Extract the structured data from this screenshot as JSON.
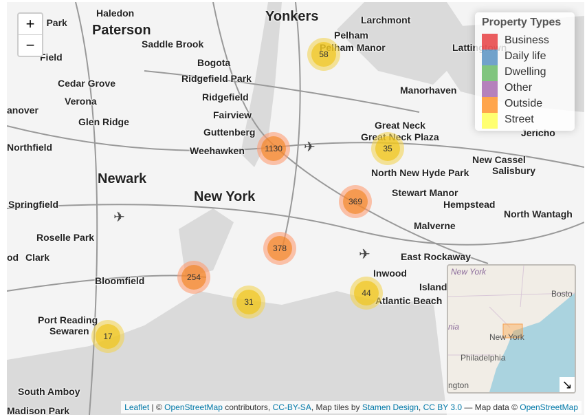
{
  "map_labels": [
    "Haledon",
    "Yonkers",
    "Larchmont",
    "Paterson",
    "Pelham",
    "Pelham Manor",
    "Lattingtown",
    "n Park",
    "Saddle Brook",
    "Bogota",
    "Field",
    "Ridgefield Park",
    "Cedar Grove",
    "Ridgefield",
    "Manorhaven",
    "Verona",
    "Fairview",
    "anover",
    "Glen Ridge",
    "Guttenberg",
    "Great Neck",
    "Great Neck Plaza",
    "Jericho",
    "Weehawken",
    "New Cassel",
    "Northfield",
    "Salisbury",
    "Newark",
    "North New Hyde Park",
    "New York",
    "Stewart Manor",
    "Springfield",
    "Hempstead",
    "North Wantagh",
    "Malverne",
    "Roselle Park",
    "od",
    "Clark",
    "East Rockaway",
    "Inwood",
    "Bloomfield",
    "Island",
    "Atlantic Beach",
    "Port Reading",
    "Sewaren",
    "South Amboy",
    "Madison Park"
  ],
  "clusters": [
    {
      "count": "58",
      "color": "yellow"
    },
    {
      "count": "1130",
      "color": "orange"
    },
    {
      "count": "35",
      "color": "yellow"
    },
    {
      "count": "369",
      "color": "orange"
    },
    {
      "count": "378",
      "color": "orange"
    },
    {
      "count": "254",
      "color": "orange"
    },
    {
      "count": "31",
      "color": "yellow"
    },
    {
      "count": "44",
      "color": "yellow"
    },
    {
      "count": "17",
      "color": "yellow"
    }
  ],
  "zoom": {
    "in": "+",
    "out": "−"
  },
  "legend": {
    "title": "Property Types",
    "items": [
      {
        "label": "Business",
        "color": "#e41a1c"
      },
      {
        "label": "Daily life",
        "color": "#377eb8"
      },
      {
        "label": "Dwelling",
        "color": "#4daf4a"
      },
      {
        "label": "Other",
        "color": "#984ea3"
      },
      {
        "label": "Outside",
        "color": "#ff7f00"
      },
      {
        "label": "Street",
        "color": "#ffff33"
      }
    ]
  },
  "minimap": {
    "labels": [
      "New York",
      "Bosto",
      "nia",
      "New York",
      "Philadelphia",
      "ngton"
    ],
    "toggle": "↘"
  },
  "attribution": {
    "leaflet": "Leaflet",
    "sep1": " | © ",
    "osm": "OpenStreetMap",
    "t1": " contributors, ",
    "ccbysa": "CC-BY-SA",
    "t2": ", Map tiles by ",
    "stamen": "Stamen Design",
    "t3": ", ",
    "ccby": "CC BY 3.0",
    "t4": " — Map data © ",
    "osm2": "OpenStreetMap"
  }
}
